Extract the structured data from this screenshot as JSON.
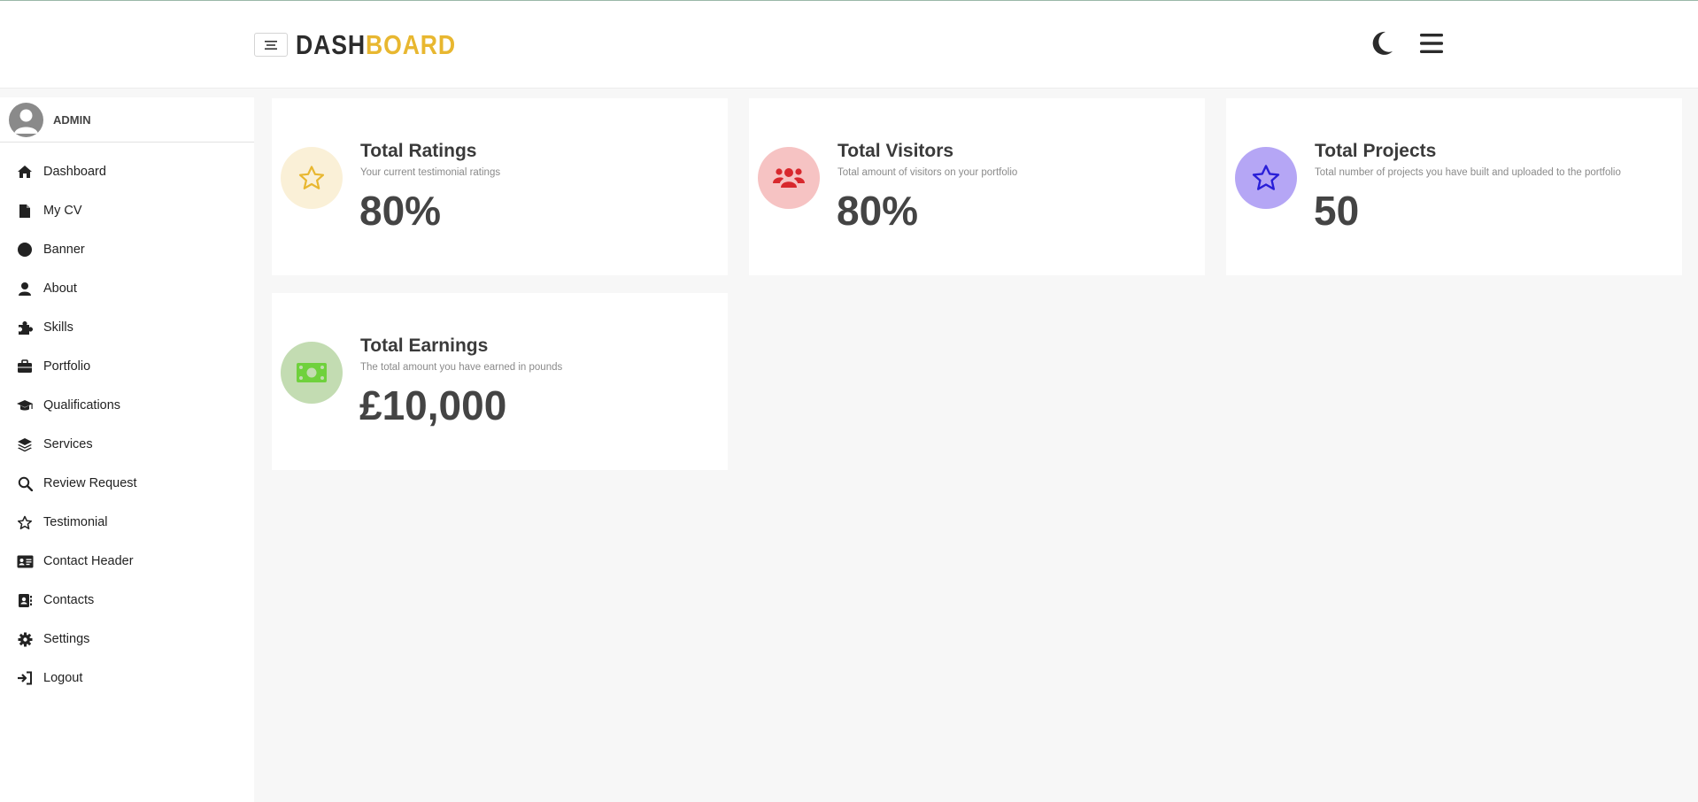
{
  "header": {
    "logo_part1": "DASH",
    "logo_part2": "BOARD",
    "icons": [
      "menu-lines-icon",
      "moon-icon",
      "hamburger-icon"
    ]
  },
  "sidebar": {
    "profile_name": "ADMIN",
    "items": [
      {
        "label": "Dashboard",
        "icon": "home-icon"
      },
      {
        "label": "My CV",
        "icon": "file-icon"
      },
      {
        "label": "Banner",
        "icon": "circle-icon"
      },
      {
        "label": "About",
        "icon": "user-icon"
      },
      {
        "label": "Skills",
        "icon": "puzzle-icon"
      },
      {
        "label": "Portfolio",
        "icon": "briefcase-icon"
      },
      {
        "label": "Qualifications",
        "icon": "graduation-cap-icon"
      },
      {
        "label": "Services",
        "icon": "layers-icon"
      },
      {
        "label": "Review Request",
        "icon": "search-icon"
      },
      {
        "label": "Testimonial",
        "icon": "star-icon"
      },
      {
        "label": "Contact Header",
        "icon": "id-card-icon"
      },
      {
        "label": "Contacts",
        "icon": "address-book-icon"
      },
      {
        "label": "Settings",
        "icon": "gear-icon"
      },
      {
        "label": "Logout",
        "icon": "logout-icon"
      }
    ]
  },
  "cards": [
    {
      "title": "Total Ratings",
      "desc": "Your current testimonial ratings",
      "value": "80%",
      "icon": "star-icon",
      "circle_color": "#faf0d7",
      "icon_color": "#e8b730"
    },
    {
      "title": "Total Visitors",
      "desc": "Total amount of visitors on your portfolio",
      "value": "80%",
      "icon": "users-icon",
      "circle_color": "#f6c3c3",
      "icon_color": "#d8282d"
    },
    {
      "title": "Total Projects",
      "desc": "Total number of projects you have built and uploaded to the portfolio",
      "value": "50",
      "icon": "star-icon",
      "circle_color": "#b5a6f5",
      "icon_color": "#2a1fd8"
    },
    {
      "title": "Total Earnings",
      "desc": "The total amount you have earned in pounds",
      "value": "£10,000",
      "icon": "money-icon",
      "circle_color": "#c3dcb2",
      "icon_color": "#6fd13d"
    }
  ]
}
